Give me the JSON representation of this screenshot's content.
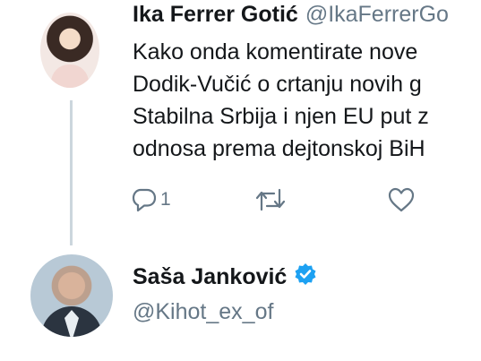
{
  "tweet": {
    "author": {
      "display_name": "Ika Ferrer Gotić",
      "handle": "@IkaFerrerGo"
    },
    "text_lines": [
      "Kako onda komentirate nove",
      "Dodik-Vučić o crtanju novih g",
      "Stabilna Srbija i njen EU put z",
      "odnosa prema dejtonskoj BiH"
    ],
    "actions": {
      "reply_count": "1",
      "reply_icon": "reply-icon",
      "retweet_icon": "retweet-icon",
      "like_icon": "heart-icon"
    }
  },
  "reply": {
    "author": {
      "display_name": "Saša Janković",
      "handle": "@Kihot_ex_of",
      "verified": true
    }
  },
  "colors": {
    "text": "#14171a",
    "secondary": "#657786",
    "thread_line": "#ccd6dd",
    "verified_blue": "#1da1f2"
  }
}
